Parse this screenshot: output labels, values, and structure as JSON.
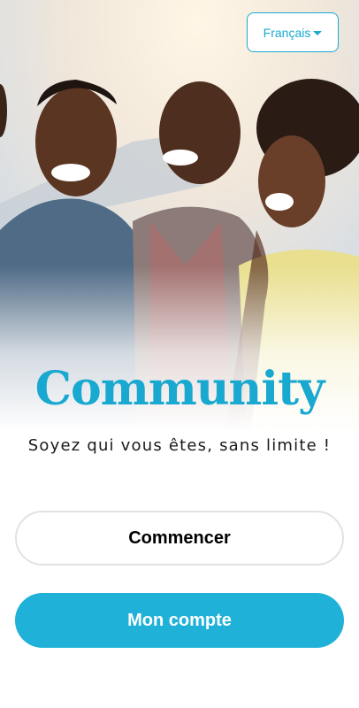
{
  "language_selector": {
    "label": "Français",
    "icon": "caret-down-icon"
  },
  "brand": {
    "logo_text": "Community",
    "tagline": "Soyez qui vous êtes, sans limite !"
  },
  "actions": {
    "start_label": "Commencer",
    "account_label": "Mon compte"
  },
  "colors": {
    "accent": "#1fb1d8",
    "logo": "#19a9d0",
    "button_outline": "#e2e2e2",
    "text": "#000000"
  }
}
